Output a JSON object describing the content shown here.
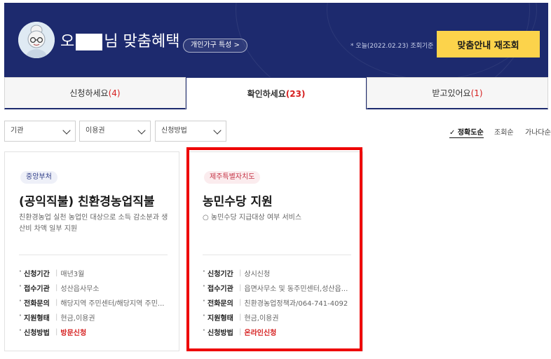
{
  "header": {
    "greeting_prefix": "오",
    "greeting_suffix": "님 맞춤혜택",
    "tag_pill": "개인가구 특성 >",
    "basis_text": "* 오늘(2022.02.23) 조회기준",
    "reinquiry_label": "맞춤안내 재조회",
    "bg_color": "#1d2a6e",
    "button_color": "#fcd34b"
  },
  "tabs": [
    {
      "label": "신청하세요",
      "count": "(4)",
      "active": false
    },
    {
      "label": "확인하세요",
      "count": "(23)",
      "active": true
    },
    {
      "label": "받고있어요",
      "count": "(1)",
      "active": false
    }
  ],
  "filters": {
    "agency": "기관",
    "voucher": "이용권",
    "method": "신청방법"
  },
  "sorts": {
    "accuracy": "✓ 정확도순",
    "views": "조회순",
    "alpha": "가나다순"
  },
  "cards": [
    {
      "badge": "중앙부처",
      "title": "(공익직불) 친환경농업직불",
      "desc": "친환경농업 실천 농업인 대상으로 소득 감소분과 생산비 차액 일부 지원",
      "rows": [
        {
          "key": "신청기간",
          "value": "매년3월"
        },
        {
          "key": "접수기관",
          "value": "성산읍사무소"
        },
        {
          "key": "전화문의",
          "value": "해당지역 주민센터/해당지역 주민..."
        },
        {
          "key": "지원형태",
          "value": "현금,이용권"
        },
        {
          "key": "신청방법",
          "value": "방문신청"
        }
      ]
    },
    {
      "badge": "제주특별자치도",
      "title": "농민수당 지원",
      "desc": "○ 농민수당 지급대상 여부 서비스",
      "rows": [
        {
          "key": "신청기간",
          "value": "상시신청"
        },
        {
          "key": "접수기관",
          "value": "읍면사무소 및 동주민센터,성산읍..."
        },
        {
          "key": "전화문의",
          "value": "친환경농업정책과/064-741-4092"
        },
        {
          "key": "지원형태",
          "value": "현금,이용권"
        },
        {
          "key": "신청방법",
          "value": "온라인신청"
        }
      ]
    }
  ],
  "highlight_color": "#ee0000"
}
